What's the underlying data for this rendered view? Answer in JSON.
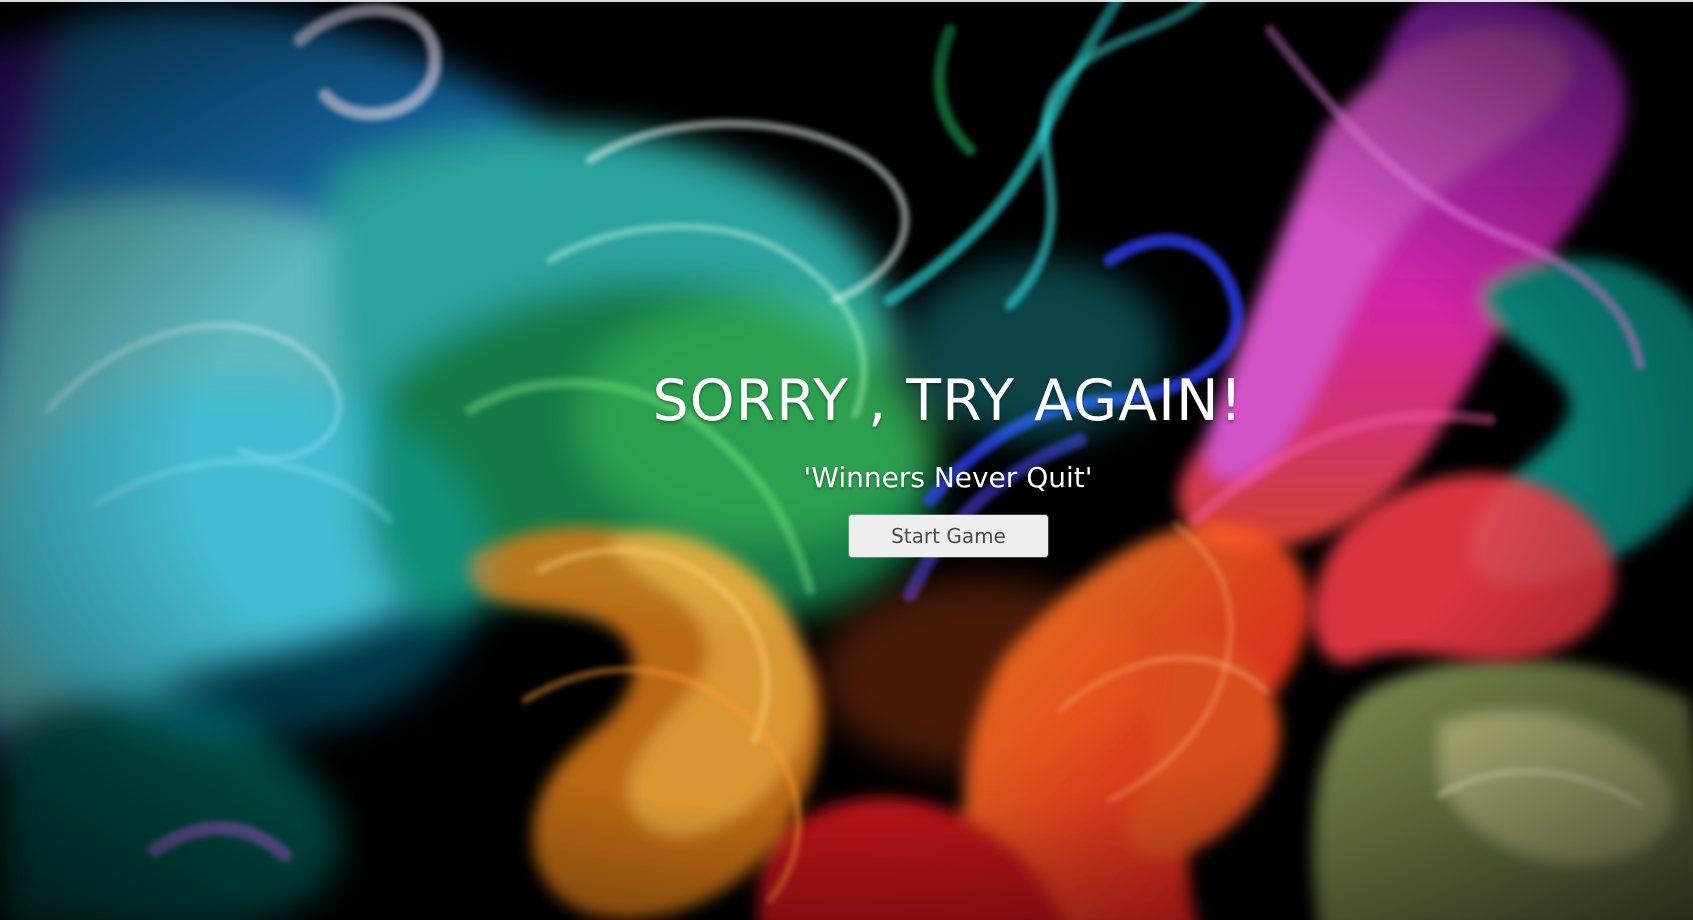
{
  "screen": {
    "title": "SORRY , TRY AGAIN!",
    "subtitle": "'Winners Never Quit'",
    "start_button_label": "Start Game"
  },
  "background": {
    "type": "colorful smoke on black",
    "colors": [
      "#000000",
      "#5f2bd4",
      "#42d7ff",
      "#1ca878",
      "#ff2bd1",
      "#ff8a22",
      "#ff2422",
      "#8cff48"
    ]
  }
}
